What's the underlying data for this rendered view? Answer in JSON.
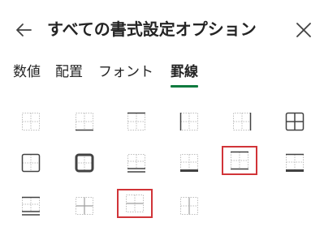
{
  "header": {
    "title": "すべての書式設定オプション",
    "back_icon": "arrow-left-icon",
    "close_icon": "close-icon"
  },
  "tabs": [
    {
      "label": "数値",
      "active": false
    },
    {
      "label": "配置",
      "active": false
    },
    {
      "label": "フォント",
      "active": false
    },
    {
      "label": "罫線",
      "active": true
    }
  ],
  "colors": {
    "accent": "#0e7a3e",
    "selection": "#d13438",
    "border_dark": "#424242",
    "guide": "#bdbdbd"
  },
  "border_presets": [
    {
      "icon": "no-border-icon",
      "selected": false
    },
    {
      "icon": "bottom-border-icon",
      "selected": false
    },
    {
      "icon": "top-border-icon",
      "selected": false
    },
    {
      "icon": "left-border-icon",
      "selected": false
    },
    {
      "icon": "right-border-icon",
      "selected": false
    },
    {
      "icon": "all-borders-icon",
      "selected": false
    },
    {
      "icon": "outside-borders-icon",
      "selected": false
    },
    {
      "icon": "thick-box-border-icon",
      "selected": false
    },
    {
      "icon": "bottom-double-border-icon",
      "selected": false
    },
    {
      "icon": "thick-bottom-border-icon",
      "selected": false
    },
    {
      "icon": "top-and-bottom-border-icon",
      "selected": true
    },
    {
      "icon": "top-and-thick-bottom-border-icon",
      "selected": false
    },
    {
      "icon": "top-and-double-bottom-border-icon",
      "selected": false
    },
    {
      "icon": "inside-borders-icon",
      "selected": false
    },
    {
      "icon": "inside-horizontal-border-icon",
      "selected": true
    },
    {
      "icon": "inside-vertical-border-icon",
      "selected": false
    }
  ]
}
